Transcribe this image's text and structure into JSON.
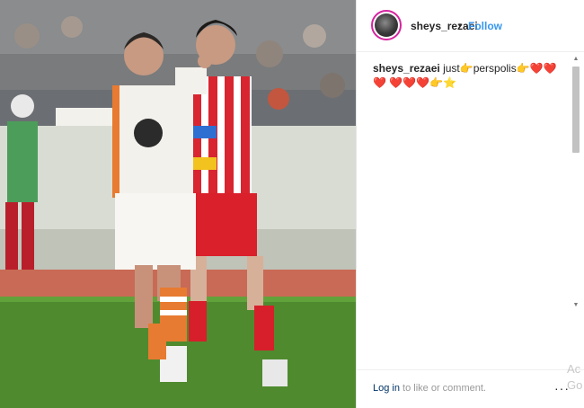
{
  "post": {
    "username": "sheys_rezaei",
    "separator": "•",
    "follow_label": "Follow",
    "caption": {
      "username": "sheys_rezaei",
      "text": "just👉perspolis👉❤️❤️❤️ ❤️❤️❤️👉⭐"
    }
  },
  "footer": {
    "login_label": "Log in",
    "login_suffix": " to like or comment.",
    "more_label": "···"
  },
  "watermark": "Ac\nGo",
  "colors": {
    "follow": "#3897f0",
    "avatar_ring": "#d6249f",
    "text": "#262626",
    "muted": "#999999"
  },
  "icons": {
    "more": "more-options-icon",
    "scroll_up": "scroll-up-icon",
    "scroll_down": "scroll-down-icon"
  }
}
